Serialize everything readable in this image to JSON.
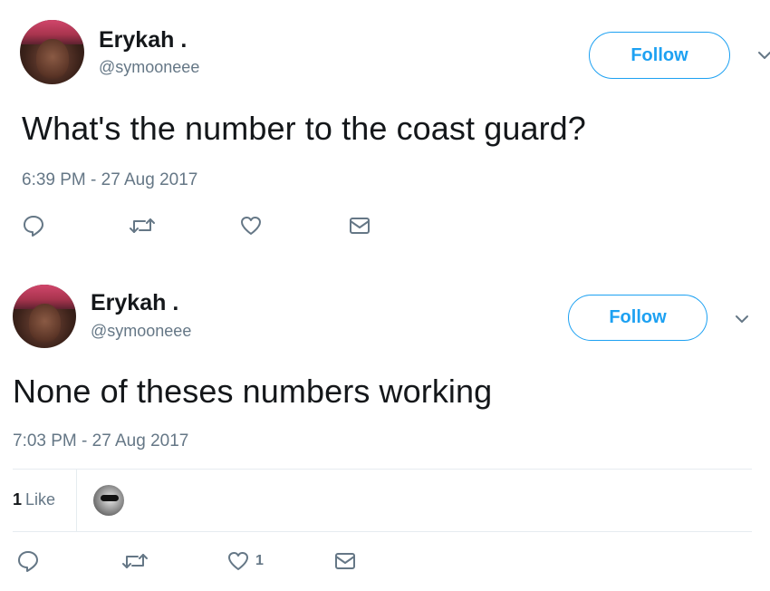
{
  "tweets": [
    {
      "name": "Erykah .",
      "handle": "@symooneee",
      "follow_label": "Follow",
      "text": "What's the number to the coast guard?",
      "timestamp": "6:39 PM - 27 Aug 2017",
      "like_count": ""
    },
    {
      "name": "Erykah .",
      "handle": "@symooneee",
      "follow_label": "Follow",
      "text": "None of theses numbers working",
      "timestamp": "7:03 PM - 27 Aug 2017",
      "likes_summary": {
        "count": "1",
        "label": "Like"
      },
      "like_count": "1"
    }
  ],
  "colors": {
    "accent": "#1da1f2",
    "muted": "#657786",
    "text": "#14171a"
  },
  "icons": [
    "reply-icon",
    "retweet-icon",
    "heart-icon",
    "direct-message-icon",
    "chevron-down-icon"
  ]
}
